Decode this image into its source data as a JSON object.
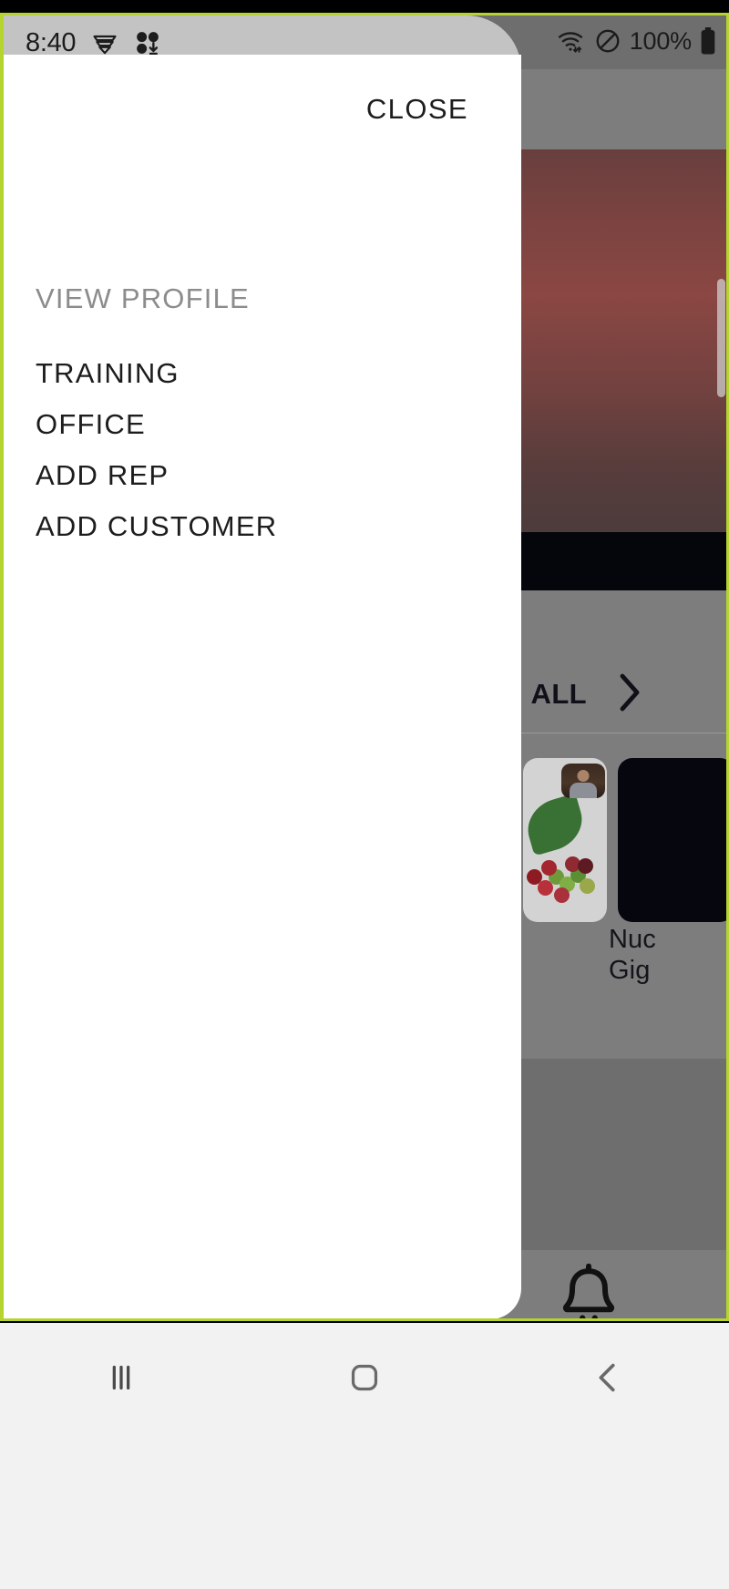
{
  "status_bar": {
    "clock": "8:40",
    "battery_percent": "100%",
    "icons": [
      "wifi-calling-icon",
      "app-download-icon",
      "wifi-icon",
      "do-not-disturb-icon",
      "battery-icon"
    ]
  },
  "drawer": {
    "close_label": "CLOSE",
    "items": [
      {
        "label": "VIEW PROFILE",
        "state": "muted",
        "name": "view-profile"
      },
      {
        "label": "TRAINING",
        "state": "normal",
        "name": "training"
      },
      {
        "label": "OFFICE",
        "state": "normal",
        "name": "office"
      },
      {
        "label": "ADD REP",
        "state": "normal",
        "name": "add-rep"
      },
      {
        "label": "ADD CUSTOMER",
        "state": "normal",
        "name": "add-customer"
      }
    ]
  },
  "background_app": {
    "section_all_label": "ALL",
    "card_label_line1": "Nuc",
    "card_label_line2": "Gig",
    "bell_icon": "notifications-bell-icon"
  },
  "nav_bar": {
    "recents_label": "|||",
    "home_icon": "home-square-icon",
    "back_icon": "back-chevron-icon"
  },
  "colors": {
    "accent_outline": "#b5d430",
    "drawer_bg": "#ffffff",
    "muted_text": "#8c8c8c",
    "primary_text": "#1d1d1d",
    "dim_overlay": "#7d7d7d",
    "hero_red": "#9c1a12"
  }
}
